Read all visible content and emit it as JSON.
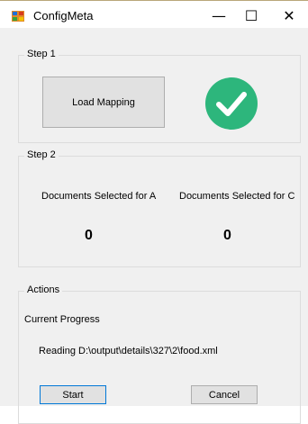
{
  "window": {
    "title": "ConfigMeta",
    "controls": {
      "minimize": "—",
      "maximize": "☐",
      "close": "✕"
    }
  },
  "step1": {
    "group_label": "Step 1",
    "load_mapping_label": "Load Mapping",
    "status_icon": "check-circle-icon",
    "status_color": "#2db67c"
  },
  "step2": {
    "group_label": "Step 2",
    "docs_a_label": "Documents Selected for A",
    "docs_a_count": "0",
    "docs_c_label": "Documents Selected for C",
    "docs_c_count": "0"
  },
  "actions": {
    "group_label": "Actions",
    "progress_label": "Current Progress",
    "progress_text": "Reading D:\\output\\details\\327\\2\\food.xml",
    "start_label": "Start",
    "cancel_label": "Cancel"
  },
  "colors": {
    "client_bg": "#f0f0f0",
    "button_bg": "#e1e1e1",
    "focus_border": "#0078d7"
  }
}
